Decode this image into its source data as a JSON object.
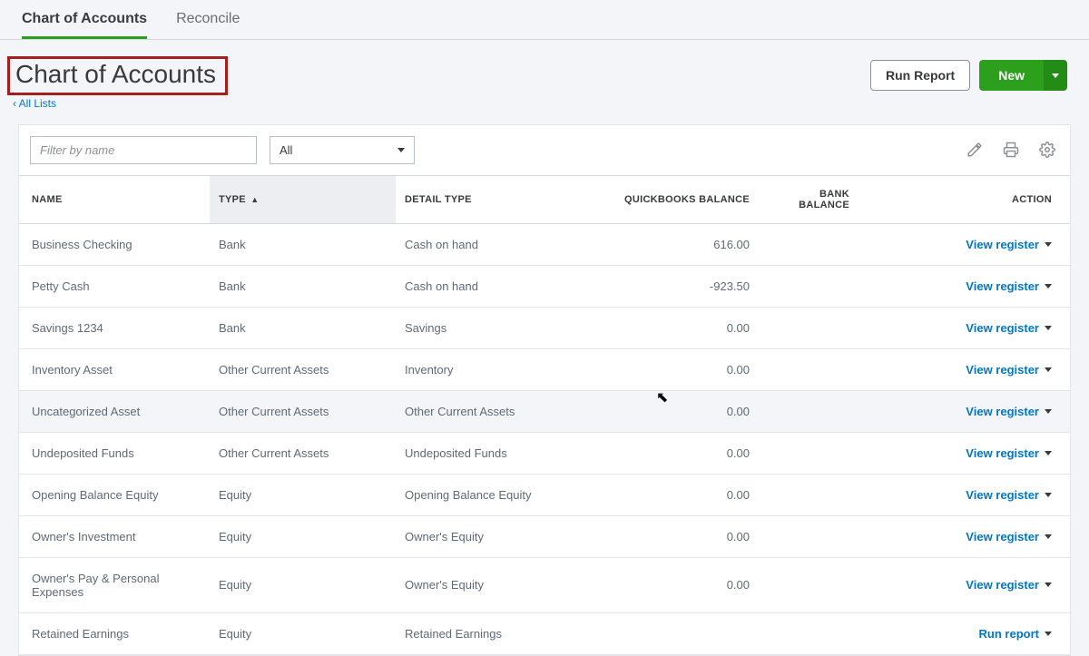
{
  "tabs": {
    "chart": "Chart of Accounts",
    "reconcile": "Reconcile"
  },
  "page": {
    "title": "Chart of Accounts",
    "back_link": "All Lists"
  },
  "header_actions": {
    "run_report": "Run Report",
    "new": "New"
  },
  "filters": {
    "name_placeholder": "Filter by name",
    "scope_selected": "All"
  },
  "table": {
    "headers": {
      "name": "NAME",
      "type": "TYPE",
      "detail_type": "DETAIL TYPE",
      "qb_balance": "QUICKBOOKS BALANCE",
      "bank_balance": "BANK BALANCE",
      "action": "ACTION"
    },
    "rows": [
      {
        "name": "Business Checking",
        "type": "Bank",
        "detail": "Cash on hand",
        "qb": "616.00",
        "bank": "",
        "action": "View register"
      },
      {
        "name": "Petty Cash",
        "type": "Bank",
        "detail": "Cash on hand",
        "qb": "-923.50",
        "bank": "",
        "action": "View register"
      },
      {
        "name": "Savings 1234",
        "type": "Bank",
        "detail": "Savings",
        "qb": "0.00",
        "bank": "",
        "action": "View register"
      },
      {
        "name": "Inventory Asset",
        "type": "Other Current Assets",
        "detail": "Inventory",
        "qb": "0.00",
        "bank": "",
        "action": "View register"
      },
      {
        "name": "Uncategorized Asset",
        "type": "Other Current Assets",
        "detail": "Other Current Assets",
        "qb": "0.00",
        "bank": "",
        "action": "View register"
      },
      {
        "name": "Undeposited Funds",
        "type": "Other Current Assets",
        "detail": "Undeposited Funds",
        "qb": "0.00",
        "bank": "",
        "action": "View register"
      },
      {
        "name": "Opening Balance Equity",
        "type": "Equity",
        "detail": "Opening Balance Equity",
        "qb": "0.00",
        "bank": "",
        "action": "View register"
      },
      {
        "name": "Owner's Investment",
        "type": "Equity",
        "detail": "Owner's Equity",
        "qb": "0.00",
        "bank": "",
        "action": "View register"
      },
      {
        "name": "Owner's Pay & Personal Expenses",
        "type": "Equity",
        "detail": "Owner's Equity",
        "qb": "0.00",
        "bank": "",
        "action": "View register"
      },
      {
        "name": "Retained Earnings",
        "type": "Equity",
        "detail": "Retained Earnings",
        "qb": "",
        "bank": "",
        "action": "Run report"
      }
    ]
  }
}
